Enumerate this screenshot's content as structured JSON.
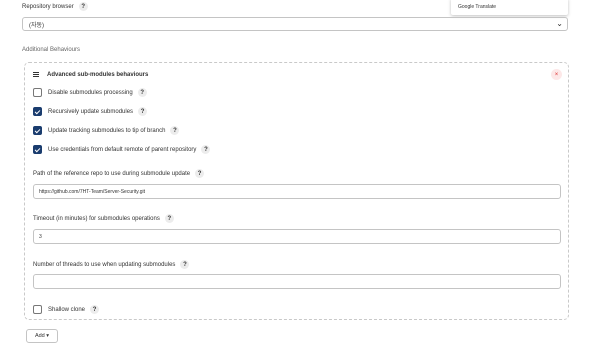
{
  "repository_browser": {
    "label": "Repository browser",
    "help": "?",
    "selected": "(자동)",
    "chevron": "⌄"
  },
  "translate_popup": {
    "text": "Google Translate"
  },
  "additional_behaviours": {
    "label": "Additional Behaviours"
  },
  "card": {
    "title": "Advanced sub-modules behaviours",
    "close": "×",
    "checkboxes": [
      {
        "label": "Disable submodules processing",
        "checked": false
      },
      {
        "label": "Recursively update submodules",
        "checked": true
      },
      {
        "label": "Update tracking submodules to tip of branch",
        "checked": true
      },
      {
        "label": "Use credentials from default remote of parent repository",
        "checked": true
      }
    ],
    "reference_repo": {
      "label": "Path of the reference repo to use during submodule update",
      "value": "https://github.com/7HT-Team/Server-Security.git"
    },
    "timeout": {
      "label": "Timeout (in minutes) for submodules operations",
      "value": "3"
    },
    "threads": {
      "label": "Number of threads to use when updating submodules",
      "value": ""
    },
    "shallow_clone": {
      "label": "Shallow clone",
      "checked": false
    }
  },
  "add_button": {
    "label": "Add ▾"
  },
  "help_glyph": "?"
}
